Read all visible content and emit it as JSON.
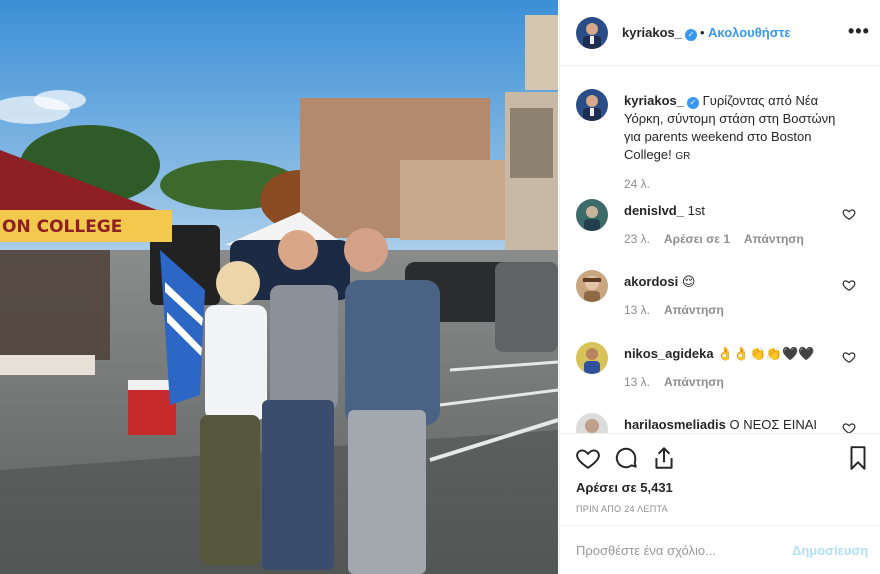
{
  "header": {
    "username": "kyriakos_",
    "follow_label": "Ακολουθήστε",
    "separator": "•"
  },
  "caption": {
    "username": "kyriakos_",
    "text": "Γυρίζοντας από Νέα Υόρκη, σύντομη στάση στη Βοστώνη για parents weekend στο Boston College!",
    "flag": "GR",
    "time": "24 λ."
  },
  "comments": [
    {
      "username": "denislvd_",
      "text": "1st",
      "time": "23 λ.",
      "likes": "Αρέσει σε 1",
      "reply": "Απάντηση"
    },
    {
      "username": "akordosi",
      "text": "😌",
      "time": "13 λ.",
      "reply": "Απάντηση"
    },
    {
      "username": "nikos_agideka",
      "text": "👌👌👏👏🖤🖤",
      "time": "13 λ.",
      "reply": "Απάντηση"
    },
    {
      "username": "harilaosmeliadis",
      "text": "Ο ΝΕΟΣ ΕΙΝΑΙ"
    }
  ],
  "footer": {
    "likes_text": "Αρέσει σε 5,431",
    "time_ago": "ΠΡΙΝ ΑΠΟ 24 ΛΕΠΤΑ",
    "comment_placeholder": "Προσθέστε ένα σχόλιο...",
    "publish_label": "Δημοσίευση"
  },
  "photo": {
    "tent_text": "ON COLLEGE"
  },
  "colors": {
    "link": "#3897f0",
    "text": "#262626",
    "muted": "#8e8e8e"
  }
}
